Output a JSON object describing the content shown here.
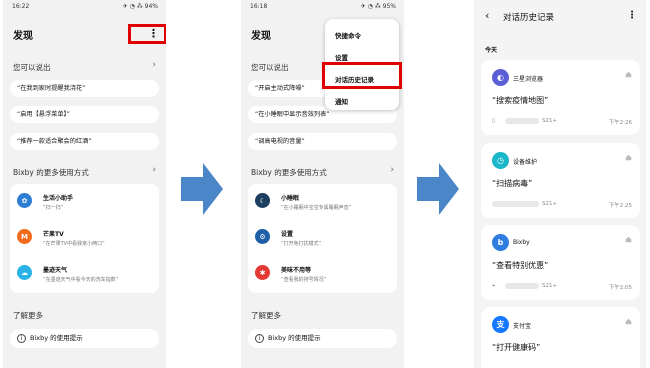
{
  "screen1": {
    "status": {
      "time": "16:22",
      "indicators": "✈ ◔ ⁂ 94%"
    },
    "title": "发现",
    "you_can_say": {
      "heading": "您可以说出",
      "items": [
        "“在我到家时提醒我浇花”",
        "“启用【悬浮菜单】”",
        "“推荐一款适合聚会的红酒”"
      ]
    },
    "more_ways": {
      "heading": "Bixby 的更多使用方式",
      "items": [
        {
          "name": "生活小助手",
          "sub": "“扫一扫”",
          "icon": "helper-icon",
          "color": "#2d7dd2"
        },
        {
          "name": "芒果TV",
          "sub": "“在芒果TV中看我家小两口”",
          "icon": "mango-tv-icon",
          "color": "#f26b1d"
        },
        {
          "name": "墨迹天气",
          "sub": "“在墨迹天气中看今天的洗车指数”",
          "icon": "weather-icon",
          "color": "#2ab3e6"
        }
      ]
    },
    "learn": {
      "heading": "了解更多",
      "tips": "Bixby 的使用提示"
    }
  },
  "screen2": {
    "status": {
      "time": "16:18",
      "indicators": "✈ ◔ ⁂ 95%"
    },
    "title": "发现",
    "you_can_say": {
      "heading": "您可以说出",
      "items": [
        "“开启主动式降噪”",
        "“在小睡眠中显示音效列表”",
        "“调高电视的音量”"
      ]
    },
    "menu": [
      "快捷命令",
      "设置",
      "对话历史记录",
      "通知"
    ],
    "more_ways": {
      "heading": "Bixby 的更多使用方式",
      "items": [
        {
          "name": "小睡眠",
          "sub": "“在小睡眠中宝宝专属睡眠声音”",
          "icon": "sleep-icon",
          "color": "#1c3f5f"
        },
        {
          "name": "设置",
          "sub": "“打开免打扰模式”",
          "icon": "settings-icon",
          "color": "#1f5fa8"
        },
        {
          "name": "美味不用等",
          "sub": "“查看我的排号情况”",
          "icon": "food-icon",
          "color": "#e53935"
        }
      ]
    },
    "learn": {
      "heading": "了解更多",
      "tips": "Bixby 的使用提示"
    }
  },
  "screen3": {
    "title": "对话历史记录",
    "day": "今天",
    "cards": [
      {
        "app": "三星浏览器",
        "query": "“搜索疫情地图”",
        "device": "S21+",
        "time": "下午2:26",
        "icon": "samsung-internet-icon",
        "color": "#5b5fd6"
      },
      {
        "app": "设备维护",
        "query": "“扫描病毒”",
        "device": "S21+",
        "time": "下午2:25",
        "icon": "device-care-icon",
        "color": "#19b7c7"
      },
      {
        "app": "Bixby",
        "query": "“查看特别优惠”",
        "device": "S21+",
        "time": "下午2:05",
        "icon": "bixby-icon",
        "color": "#2f7de1"
      },
      {
        "app": "支付宝",
        "query": "“打开健康码”",
        "device": "",
        "time": "",
        "icon": "alipay-icon",
        "color": "#1677ff"
      }
    ]
  },
  "colors": {
    "highlight": "#e00000",
    "arrow": "#4a86c8"
  }
}
